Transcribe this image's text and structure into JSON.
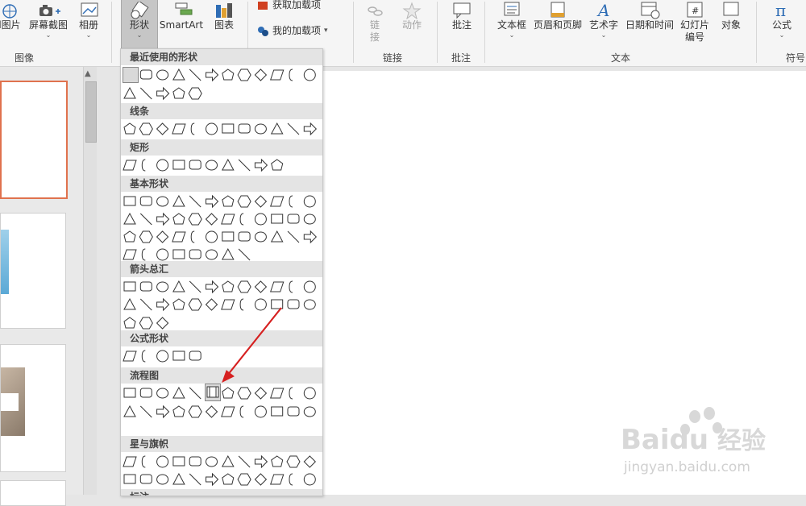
{
  "ribbon": {
    "picture": "l图片",
    "screenshot": "屏幕截图",
    "album": "相册",
    "group_images": "图像",
    "shapes": "形状",
    "smartart": "SmartArt",
    "chart": "图表",
    "get_addins": "获取加载项",
    "my_addins": "我的加载项",
    "link": "链\n接",
    "link_top": "链",
    "link_bottom": "接",
    "action": "动作",
    "group_links": "链接",
    "comment": "批注",
    "group_comments": "批注",
    "textbox": "文本框",
    "header_footer": "页眉和页脚",
    "wordart": "艺术字",
    "datetime": "日期和时间",
    "slide_number_1": "幻灯片",
    "slide_number_2": "编号",
    "object": "对象",
    "group_text": "文本",
    "equation": "公式",
    "group_symbols": "符号"
  },
  "gallery": {
    "sections": [
      {
        "title": "最近使用的形状"
      },
      {
        "title": "线条"
      },
      {
        "title": "矩形"
      },
      {
        "title": "基本形状"
      },
      {
        "title": "箭头总汇"
      },
      {
        "title": "公式形状"
      },
      {
        "title": "流程图"
      },
      {
        "title": "星与旗帜"
      },
      {
        "title": "标注"
      }
    ],
    "hovered_shape": "flowchart-predefined-process"
  },
  "watermark": {
    "brand": "Baidu",
    "cn": "经验",
    "url": "jingyan.baidu.com"
  },
  "colors": {
    "accent_orange": "#e0724e",
    "arrow_red": "#d62020",
    "ribbon_bg": "#f5f5f5"
  }
}
